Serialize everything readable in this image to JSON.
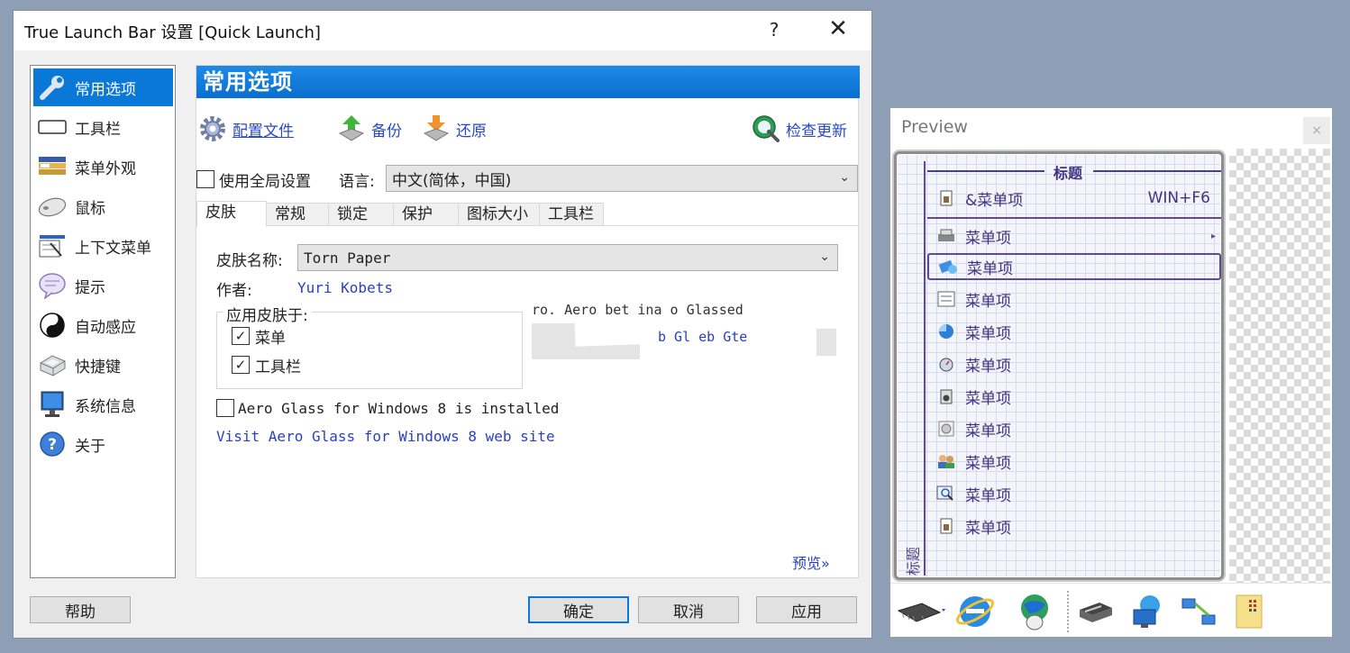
{
  "dialog": {
    "title": "True Launch Bar 设置 [Quick Launch]",
    "help_glyph": "?",
    "close_glyph": "✕"
  },
  "nav": {
    "items": [
      {
        "label": "常用选项",
        "icon": "wrench-icon",
        "active": true
      },
      {
        "label": "工具栏",
        "icon": "toolbar-icon"
      },
      {
        "label": "菜单外观",
        "icon": "menu-appearance-icon"
      },
      {
        "label": "鼠标",
        "icon": "mouse-icon"
      },
      {
        "label": "上下文菜单",
        "icon": "context-menu-icon"
      },
      {
        "label": "提示",
        "icon": "tooltip-icon"
      },
      {
        "label": "自动感应",
        "icon": "yin-yang-icon"
      },
      {
        "label": "快捷键",
        "icon": "keyboard-key-icon"
      },
      {
        "label": "系统信息",
        "icon": "monitor-icon"
      },
      {
        "label": "关于",
        "icon": "help-icon"
      }
    ]
  },
  "content": {
    "header": "常用选项",
    "actions": {
      "config": "配置文件",
      "backup": "备份",
      "restore": "还原",
      "update": "检查更新"
    },
    "global_settings_label": "使用全局设置",
    "language_label": "语言:",
    "language_value": "中文(简体，中国)",
    "tabs": [
      "皮肤",
      "常规",
      "锁定",
      "保护",
      "图标大小",
      "工具栏"
    ],
    "skin": {
      "name_label": "皮肤名称:",
      "name_value": "Torn Paper",
      "author_label": "作者:",
      "author_value": "Yuri Kobets",
      "apply_group_label": "应用皮肤于:",
      "apply_menu": "菜单",
      "apply_toolbar": "工具栏",
      "preview_text_1": "ro. Aero bet   ina o Glassed",
      "preview_text_2": "b Gl eb Gte",
      "aero_label": "Aero Glass for Windows 8 is installed",
      "aero_link": "Visit Aero Glass for Windows 8 web site",
      "preview_link": "预览»"
    }
  },
  "buttons": {
    "help": "帮助",
    "ok": "确定",
    "cancel": "取消",
    "apply": "应用"
  },
  "preview": {
    "title": "Preview",
    "close_glyph": "×",
    "menu_title": "标题",
    "side_title": "标题",
    "first_item": "&菜单项",
    "first_shortcut": "WIN+F6",
    "item_label": "菜单项",
    "submenu_arrow": "▸"
  },
  "colors": {
    "accent": "#0a78d7",
    "link": "#2a48c8",
    "menu_ink": "#3f3480"
  }
}
